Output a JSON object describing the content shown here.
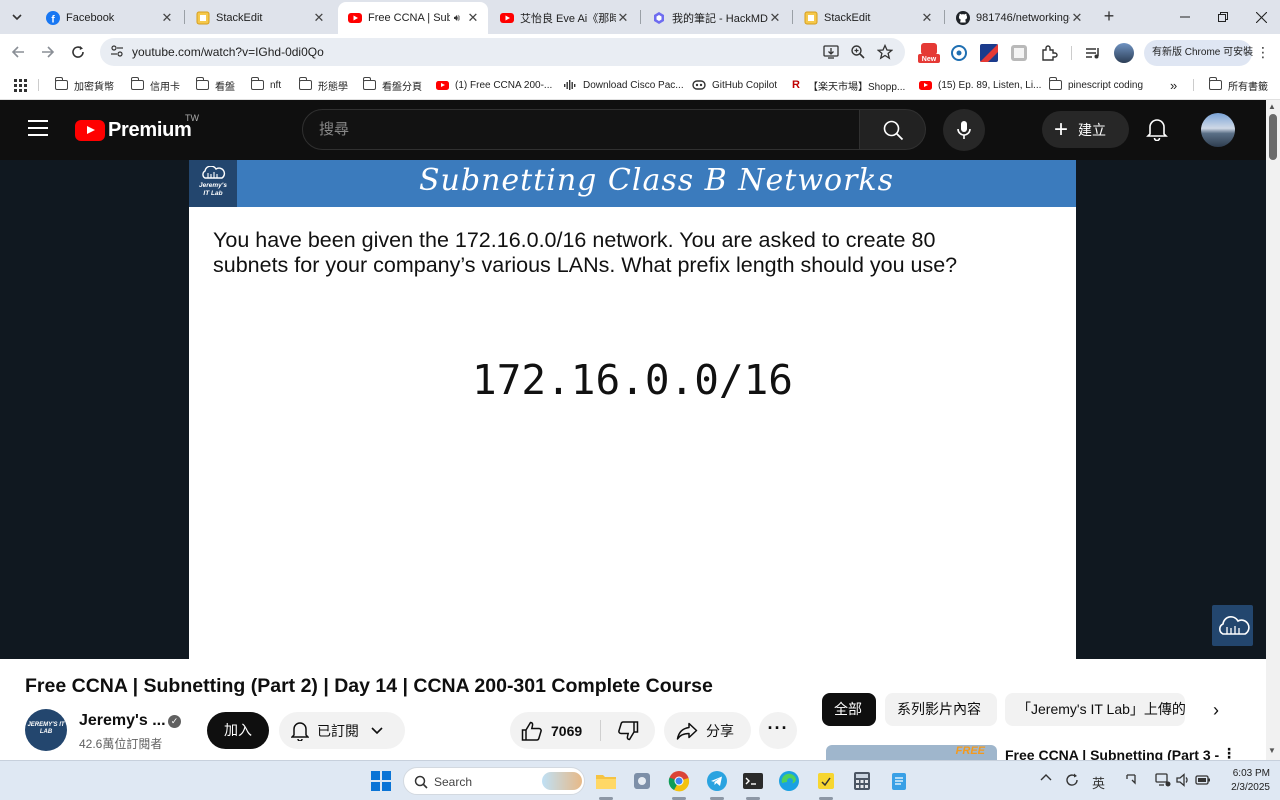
{
  "browser": {
    "tabs": [
      {
        "title": "Facebook"
      },
      {
        "title": "StackEdit"
      },
      {
        "title": "Free CCNA | Subn",
        "active": true
      },
      {
        "title": "艾怡良 Eve Ai《那時"
      },
      {
        "title": "我的筆記 - HackMD"
      },
      {
        "title": "StackEdit"
      },
      {
        "title": "981746/networking-"
      }
    ],
    "url": "youtube.com/watch?v=IGhd-0di0Qo",
    "update_button": "有新版 Chrome 可安裝",
    "extension_badge": "New",
    "bookmarks": [
      {
        "label": "加密貨幣",
        "icon": "folder-icon"
      },
      {
        "label": "信用卡",
        "icon": "folder-icon"
      },
      {
        "label": "看盤",
        "icon": "folder-icon"
      },
      {
        "label": "nft",
        "icon": "folder-icon"
      },
      {
        "label": "形態學",
        "icon": "folder-icon"
      },
      {
        "label": "看盤分頁",
        "icon": "folder-icon"
      },
      {
        "label": "(1) Free CCNA 200-...",
        "icon": "youtube-icon"
      },
      {
        "label": "Download Cisco Pac...",
        "icon": "cisco-icon"
      },
      {
        "label": "GitHub Copilot",
        "icon": "copilot-icon"
      },
      {
        "label": "【楽天市場】Shopp...",
        "icon": "rakuten-icon"
      },
      {
        "label": "(15) Ep. 89, Listen, Li...",
        "icon": "youtube-icon"
      },
      {
        "label": "pinescript coding",
        "icon": "folder-icon"
      }
    ],
    "more_bookmarks": "»",
    "all_bookmarks": "所有書籤"
  },
  "youtube": {
    "logo_text": "Premium",
    "region": "TW",
    "search_placeholder": "搜尋",
    "create_label": "建立"
  },
  "slide": {
    "logo_text": "Jeremy's IT Lab",
    "title": "Subnetting Class B Networks",
    "question": "You have been given the 172.16.0.0/16 network.  You are asked to create 80\nsubnets for your company’s various LANs.  What prefix length should you use?",
    "network": "172.16.0.0/16"
  },
  "video": {
    "title": "Free CCNA | Subnetting (Part 2) | Day 14 | CCNA 200-301 Complete Course",
    "channel_name": "Jeremy's ...",
    "channel_avatar_text": "JEREMY'S IT LAB",
    "subscribers": "42.6萬位訂閱者",
    "join_label": "加入",
    "subscribed_label": "已訂閱",
    "likes": "7069",
    "share_label": "分享",
    "more_label": "···"
  },
  "sidebar": {
    "chips": [
      "全部",
      "系列影片內容",
      "「Jeremy's IT Lab」上傳的"
    ],
    "rec_title": "Free CCNA | Subnetting (Part 3 -",
    "rec_thumb_text": "FREE"
  },
  "taskbar": {
    "search_label": "Search",
    "ime": "英",
    "time": "6:03 PM",
    "date": "2/3/2025"
  },
  "colors": {
    "youtube_red": "#ff0000",
    "slide_header": "#3b7bbd",
    "slide_logo_bg": "#23466e"
  }
}
